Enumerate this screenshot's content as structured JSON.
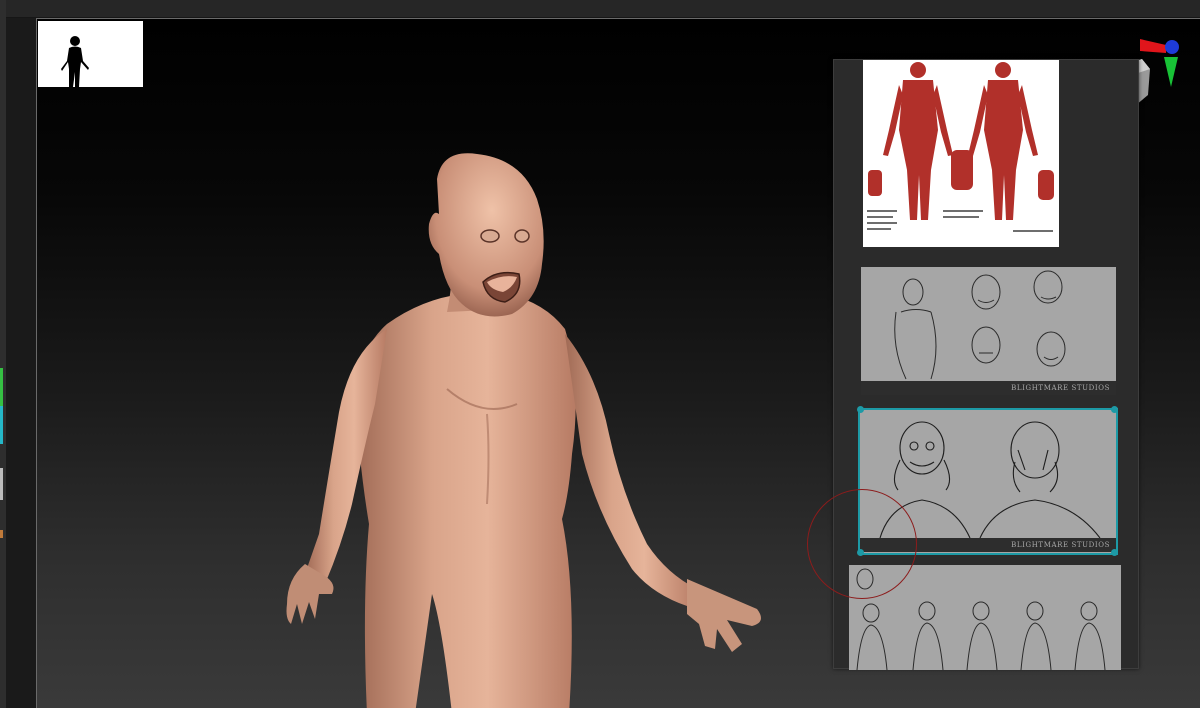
{
  "app": {
    "accent_color": "#1d9aa6",
    "background_gradient": [
      "#000000",
      "#3a3a3a"
    ]
  },
  "viewport": {
    "silhouette_thumbnail": {
      "icon": "human-silhouette-icon"
    },
    "model": {
      "description_icon": "sculpted-humanoid-model"
    },
    "gizmo": {
      "icon": "axis-gizmo-icon"
    }
  },
  "reference_board": {
    "images": [
      {
        "name": "anatomy-chart",
        "caption": ""
      },
      {
        "name": "face-sketches",
        "caption": "BLIGHTMARE STUDIOS"
      },
      {
        "name": "hands-on-face-sketches",
        "caption": "BLIGHTMARE STUDIOS",
        "selected": true
      },
      {
        "name": "body-sketches",
        "caption": ""
      }
    ]
  }
}
